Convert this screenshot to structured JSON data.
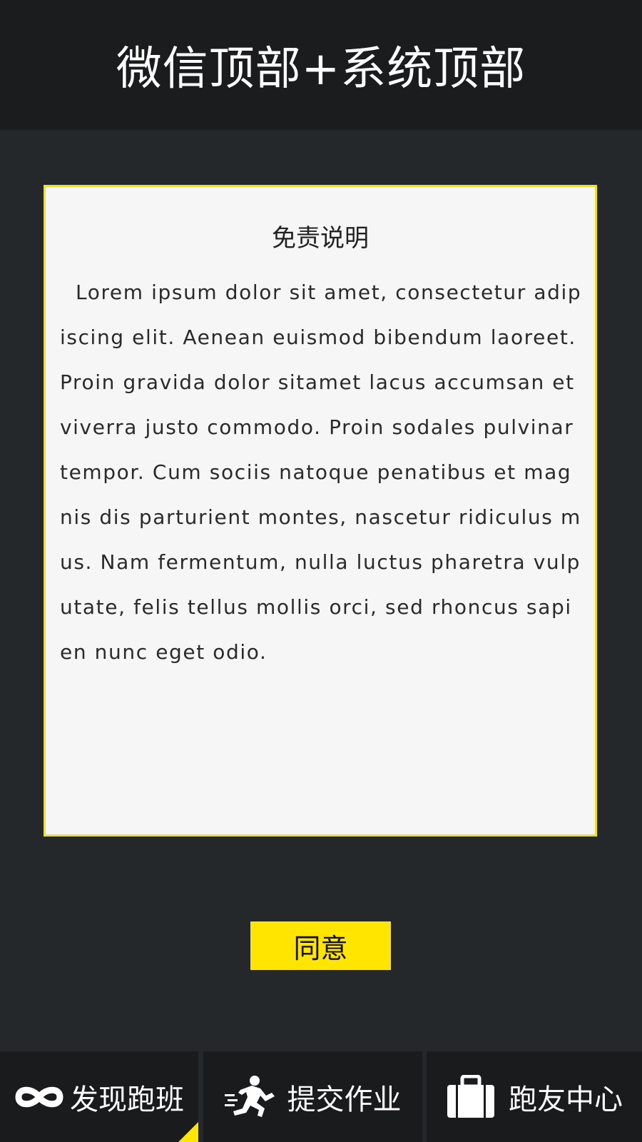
{
  "header": {
    "title": "微信顶部+系统顶部"
  },
  "disclaimer": {
    "title": "免责说明",
    "body": "Lorem ipsum dolor sit amet, consectetur adipiscing elit. Aenean euismod bibendum laoreet. Proin gravida dolor sitamet lacus accumsan et viverra justo commodo. Proin sodales pulvinar tempor. Cum sociis natoque penatibus et magnis dis parturient montes, nascetur ridiculus mus. Nam fermentum, nulla luctus pharetra vulputate, felis tellus mollis orci, sed rhoncus sapien nunc eget odio."
  },
  "agree_button": {
    "label": "同意"
  },
  "bottom_nav": {
    "items": [
      {
        "label": "发现跑班",
        "icon": "infinity-icon",
        "active": true
      },
      {
        "label": "提交作业",
        "icon": "runner-icon",
        "active": false
      },
      {
        "label": "跑友中心",
        "icon": "briefcase-icon",
        "active": false
      }
    ]
  },
  "colors": {
    "accent": "#ffe500",
    "card_border": "#f4e400",
    "background": "#25282b",
    "topbar": "#1b1c1d",
    "card_bg": "#f6f6f6"
  }
}
